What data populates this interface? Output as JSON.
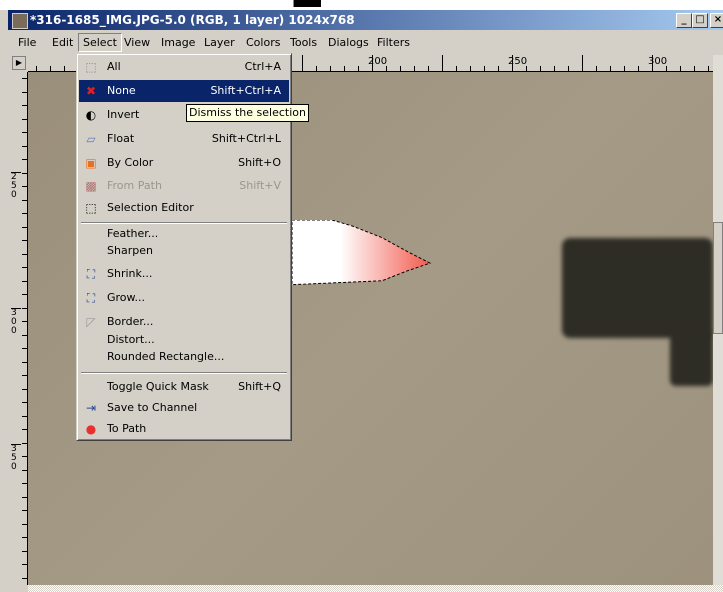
{
  "window": {
    "title": "*316-1685_IMG.JPG-5.0 (RGB, 1 layer) 1024x768",
    "minimize": "_",
    "maximize": "□",
    "close": "×"
  },
  "menubar": [
    {
      "label": "File"
    },
    {
      "label": "Edit"
    },
    {
      "label": "Select",
      "open": true
    },
    {
      "label": "View"
    },
    {
      "label": "Image"
    },
    {
      "label": "Layer"
    },
    {
      "label": "Colors"
    },
    {
      "label": "Tools"
    },
    {
      "label": "Dialogs"
    },
    {
      "label": "Filters"
    }
  ],
  "rulers": {
    "horizontal": [
      "200",
      "250",
      "300"
    ],
    "vertical": [
      "250",
      "300",
      "350"
    ]
  },
  "select_menu": {
    "items": [
      {
        "label": "All",
        "shortcut": "Ctrl+A",
        "icon": "select-all-icon"
      },
      {
        "label": "None",
        "shortcut": "Shift+Ctrl+A",
        "icon": "select-none-icon",
        "highlighted": true
      },
      {
        "label": "Invert",
        "shortcut": "",
        "icon": "invert-icon"
      },
      {
        "label": "Float",
        "shortcut": "Shift+Ctrl+L",
        "icon": "float-icon"
      },
      {
        "label": "By Color",
        "shortcut": "Shift+O",
        "icon": "by-color-icon"
      },
      {
        "label": "From Path",
        "shortcut": "Shift+V",
        "icon": "from-path-icon",
        "disabled": true
      },
      {
        "label": "Selection Editor",
        "shortcut": "",
        "icon": "selection-editor-icon"
      },
      {
        "label": "Feather...",
        "shortcut": ""
      },
      {
        "label": "Sharpen",
        "shortcut": ""
      },
      {
        "label": "Shrink...",
        "shortcut": "",
        "icon": "shrink-icon"
      },
      {
        "label": "Grow...",
        "shortcut": "",
        "icon": "grow-icon"
      },
      {
        "label": "Border...",
        "shortcut": "",
        "icon": "border-icon"
      },
      {
        "label": "Distort...",
        "shortcut": ""
      },
      {
        "label": "Rounded Rectangle...",
        "shortcut": ""
      },
      {
        "label": "Toggle Quick Mask",
        "shortcut": "Shift+Q"
      },
      {
        "label": "Save to Channel",
        "shortcut": "",
        "icon": "save-to-channel-icon"
      },
      {
        "label": "To Path",
        "shortcut": "",
        "icon": "to-path-icon"
      }
    ]
  },
  "tooltip": "Dismiss the selection",
  "colors": {
    "highlight": "#0a246a",
    "menu_bg": "#d4d0c8",
    "tooltip_bg": "#ffffe1",
    "canvas": "#9d927e"
  }
}
